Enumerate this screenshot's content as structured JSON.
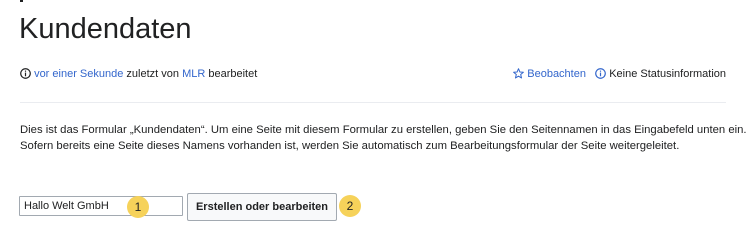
{
  "page": {
    "title": "Kundendaten"
  },
  "meta": {
    "time_link": "vor einer Sekunde",
    "edited_by_text": "zuletzt von",
    "user_link": "MLR",
    "edited_suffix": "bearbeitet",
    "watch_label": "Beobachten",
    "status_label": "Keine Statusinformation"
  },
  "intro": {
    "line1": "Dies ist das Formular „Kundendaten“. Um eine Seite mit diesem Formular zu erstellen, geben Sie den Seitennamen in das Eingabefeld unten ein.",
    "line2": "Sofern bereits eine Seite dieses Namens vorhanden ist, werden Sie automatisch zum Bearbeitungsformular der Seite weitergeleitet."
  },
  "form": {
    "input_value": "Hallo Welt GmbH",
    "submit_label": "Erstellen oder bearbeiten"
  },
  "annotations": {
    "marker1": "1",
    "marker2": "2",
    "color": "#f6d25a"
  },
  "colors": {
    "link": "#3366cc",
    "text": "#202122"
  },
  "icons": [
    "info-icon",
    "star-icon",
    "info-icon"
  ]
}
